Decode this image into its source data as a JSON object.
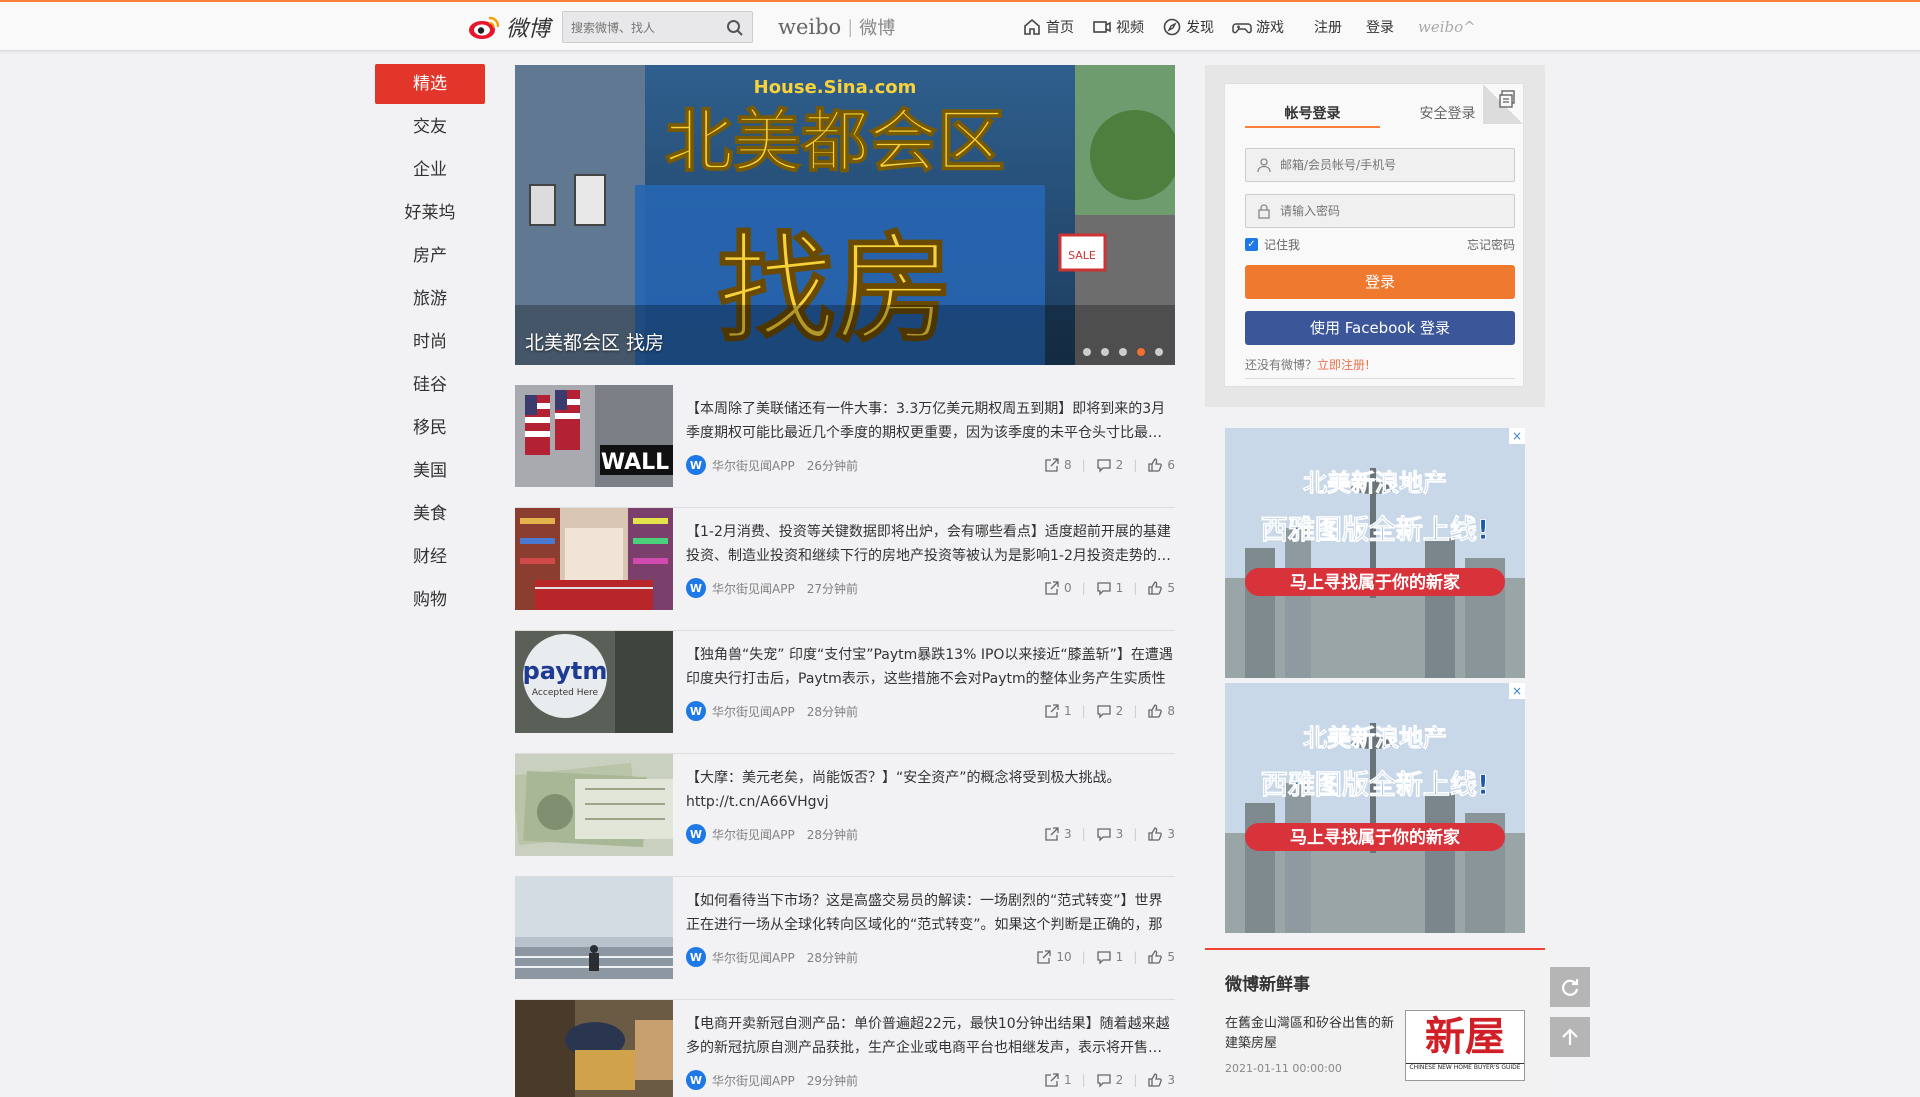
{
  "header": {
    "logo_text": "微博",
    "search_placeholder": "搜索微博、找人",
    "brand_en": "weibo",
    "brand_sep": "|",
    "brand_cn": "微博",
    "nav": [
      {
        "label": "首页",
        "icon": "home-icon"
      },
      {
        "label": "视频",
        "icon": "video-icon"
      },
      {
        "label": "发现",
        "icon": "compass-icon"
      },
      {
        "label": "游戏",
        "icon": "gamepad-icon"
      }
    ],
    "register_label": "注册",
    "login_label": "登录",
    "weibo_small": "weibo^"
  },
  "channels": [
    "精选",
    "交友",
    "企业",
    "好莱坞",
    "房产",
    "旅游",
    "时尚",
    "硅谷",
    "移民",
    "美国",
    "美食",
    "财经",
    "购物"
  ],
  "hero": {
    "site": "House.Sina.com",
    "headline": "北美都会区",
    "big_text": "找房",
    "sale_sign": "FOR SALE",
    "caption": "北美都会区 找房",
    "dots": 5,
    "active_dot": 3
  },
  "feed": [
    {
      "text": "【本周除了美联储还有一件大事：3.3万亿美元期权周五到期】即将到来的3月季度期权可能比最近几个季度的期权更重要，因为该季度的未平仓头寸比最…",
      "source": "华尔街见闻APP",
      "time": "26分钟前",
      "shares": "8",
      "comments": "2",
      "likes": "6",
      "thumb": "wall-street"
    },
    {
      "text": "【1-2月消费、投资等关键数据即将出炉，会有哪些看点】适度超前开展的基建投资、制造业投资和继续下行的房地产投资等被认为是影响1-2月投资走势的…",
      "source": "华尔街见闻APP",
      "time": "27分钟前",
      "shares": "0",
      "comments": "1",
      "likes": "5",
      "thumb": "shopping-cart"
    },
    {
      "text": "【独角兽“失宠” 印度“支付宝”Paytm暴跌13% IPO以来接近“膝盖斩”】在遭遇印度央行打击后，Paytm表示，这些措施不会对Paytm的整体业务产生实质性的…",
      "source": "华尔街见闻APP",
      "time": "28分钟前",
      "shares": "1",
      "comments": "2",
      "likes": "8",
      "thumb": "paytm"
    },
    {
      "text": "【大摩：美元老矣，尚能饭否？】“安全资产”的概念将受到极大挑战。http://t.cn/A66VHgvj",
      "source": "华尔街见闻APP",
      "time": "28分钟前",
      "shares": "3",
      "comments": "3",
      "likes": "3",
      "thumb": "dollars"
    },
    {
      "text": "【如何看待当下市场？这是高盛交易员的解读：一场剧烈的“范式转变”】世界正在进行一场从全球化转向区域化的“范式转变”。如果这个判断是正确的，那么…",
      "source": "华尔街见闻APP",
      "time": "28分钟前",
      "shares": "10",
      "comments": "1",
      "likes": "5",
      "thumb": "man-fog"
    },
    {
      "text": "【电商开卖新冠自测产品：单价普遍超22元，最快10分钟出结果】随着越来越多的新冠抗原自测产品获批，生产企业或电商平台也相继发声，表示将开售…",
      "source": "华尔街见闻APP",
      "time": "29分钟前",
      "shares": "1",
      "comments": "2",
      "likes": "3",
      "thumb": "test-kit"
    }
  ],
  "login": {
    "tab_account": "帐号登录",
    "tab_secure": "安全登录",
    "username_placeholder": "邮箱/会员帐号/手机号",
    "password_placeholder": "请输入密码",
    "remember_label": "记住我",
    "forgot_label": "忘记密码",
    "login_button": "登录",
    "facebook_button": "使用 Facebook 登录",
    "no_account": "还没有微博？",
    "register_now": "立即注册!"
  },
  "ad": {
    "line1": "北美新浪地产",
    "line2": "西雅图版全新上线!",
    "line3": "马上寻找属于你的新家",
    "close": "×"
  },
  "fresh": {
    "title": "微博新鲜事",
    "text": "在舊金山灣區和矽谷出售的新建築房屋",
    "date": "2021-01-11 00:00:00",
    "img_text": "新屋",
    "img_sub": "CHINESE NEW HOME BUYER'S GUIDE"
  },
  "colors": {
    "accent": "#fa7d3c",
    "channel_active": "#e2362b",
    "login_button": "#f07930",
    "facebook": "#3b5699"
  }
}
